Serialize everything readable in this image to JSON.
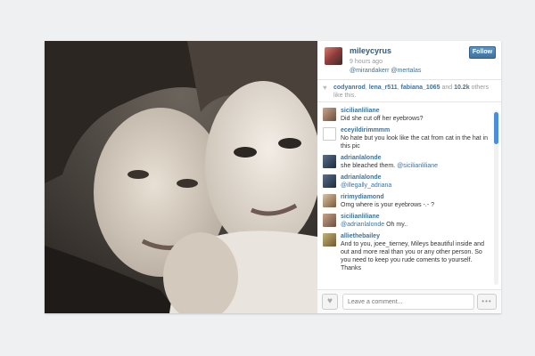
{
  "post": {
    "username": "mileycyrus",
    "time": "9 hours ago",
    "mentions": "@mirandakerr @mertalas",
    "follow_label": "Follow"
  },
  "likes": {
    "user1": "codyanrod",
    "user2": "lena_r511",
    "user3": "fabiana_1065",
    "and": "and",
    "count": "10.2k",
    "suffix": "others like this."
  },
  "comments": [
    {
      "user": "sicilianliliane",
      "text": "Did she cut off her eyebrows?",
      "mention": ""
    },
    {
      "user": "eceyildirimmmm",
      "text": "No hate but you look like the cat from cat in the hat in this pic",
      "mention": ""
    },
    {
      "user": "adrianlalonde",
      "text": "she bleached them.",
      "mention": "@sicilianliliane"
    },
    {
      "user": "adrianlalonde",
      "text": "",
      "mention": "@illegally_adriana"
    },
    {
      "user": "ririmydiamond",
      "text": "Omg where is your eyebrows -.- ?",
      "mention": ""
    },
    {
      "user": "sicilianliliane",
      "text": "Oh my..",
      "mention": "@adrianlalonde"
    },
    {
      "user": "alliethebailey",
      "text": "And to you, joee_tierney, Mileys beautiful inside and out and more real than you or any other person. So you need to keep you rude coments to yourself. Thanks",
      "mention": ""
    }
  ],
  "footer": {
    "comment_placeholder": "Leave a comment...",
    "more_label": "•••"
  },
  "icons": {
    "like": "heart-icon",
    "more": "more-icon"
  },
  "colors": {
    "link": "#3f729b",
    "follow": "#3f729b",
    "scroll_thumb": "#4a90d9"
  }
}
